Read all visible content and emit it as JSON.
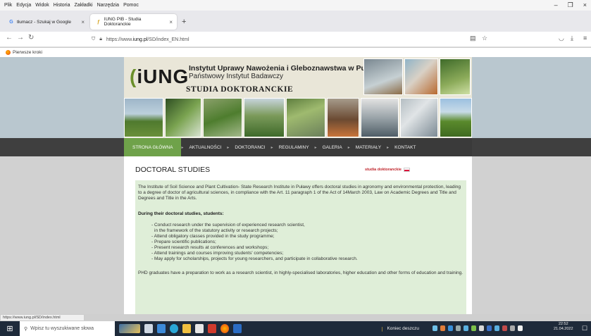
{
  "browser": {
    "menu": [
      "Plik",
      "Edycja",
      "Widok",
      "Historia",
      "Zakładki",
      "Narzędzia",
      "Pomoc"
    ],
    "tabs": [
      {
        "label": "tłumacz - Szukaj w Google",
        "icon": "google-icon",
        "active": false
      },
      {
        "label": "IUNG PIB - Studia Doktoranckie",
        "icon": "iung-favicon-icon",
        "active": true
      }
    ],
    "url": {
      "prefix": "https://www.",
      "domain": "iung.pl",
      "path": "/SD/index_EN.html"
    },
    "bookmark": "Pierwsze kroki",
    "status_url": "https://www.iung.pl/SD/index.html"
  },
  "site": {
    "logo": "iUNG",
    "institute": "Instytut Uprawy Nawożenia i Gleboznawstwa w Puławach",
    "institute_sub": "Państwowy Instytut Badawczy",
    "studia": "STUDIA DOKTORANCKIE",
    "nav": [
      "STRONA GŁÓWNA",
      "AKTUALNOŚCI",
      "DOKTORANCI",
      "REGULAMINY",
      "GALERIA",
      "MATERIAŁY",
      "KONTAKT"
    ],
    "page_title": "DOCTORAL STUDIES",
    "badge": "studia doktoranckie",
    "intro": "The Institute of Soil Science and Plant Cultivation- State Research Institute in Puławy offers doctoral studies in agronomy and environmental protection, leading to a degree of doctor of agricultural sciences, in compliance with the Art. 11 paragraph 1 of the Act of 14March 2003, Law on Academic Degrees and Title and Degrees and Title in the Arts.",
    "during_heading": "During their doctoral studies, students:",
    "duties": [
      "- Conduct research under the supervision of experienced research scientist,",
      "  in the framework of the statutory activity or research projects;",
      "- Attend obligatory classes provided in the study programme;",
      "- Prepare scientific publications;",
      "- Present  research results at conferences and workshops;",
      "- Attend trainings and courses improving students' competencies;",
      "- May apply for scholarships, projects for young researchers, and participate in collaborative research."
    ],
    "outro": "PHD graduates have a preparation to work as a research scientist, in highly-specialised laboratories, higher education and other forms of education and training."
  },
  "taskbar": {
    "search_placeholder": "Wpisz tu wyszukiwane słowa",
    "weather": "Koniec deszczu",
    "time": "22:52",
    "date": "21.04.2022"
  }
}
